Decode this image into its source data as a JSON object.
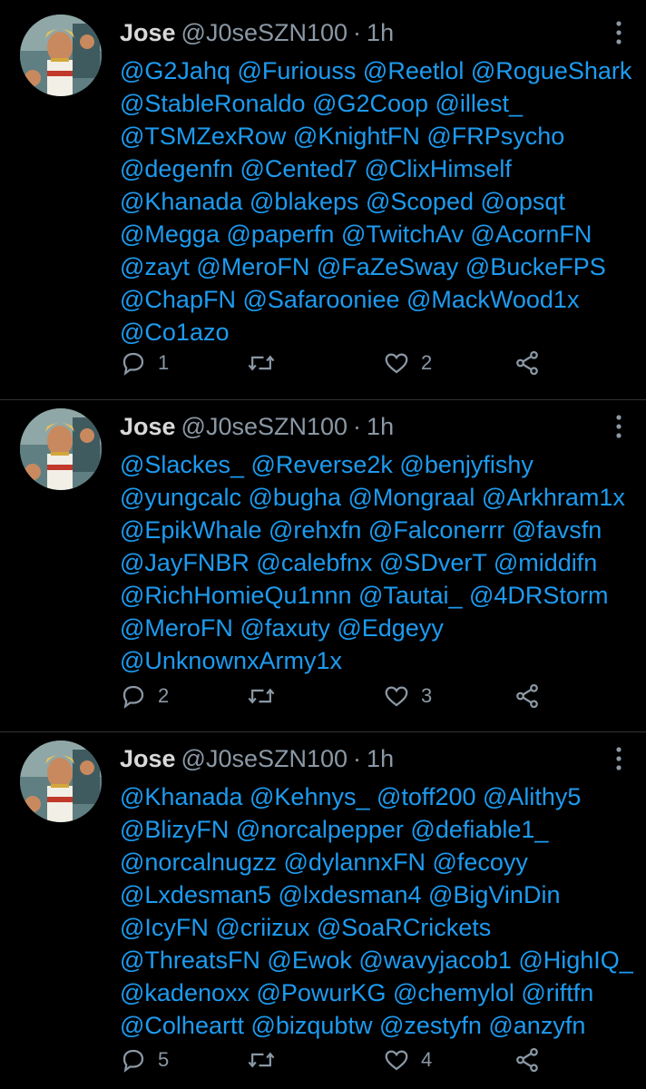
{
  "colors": {
    "background": "#000000",
    "divider": "#2f3336",
    "name": "#d9d9d9",
    "secondary": "#8b98a5",
    "mention": "#1d9bf0"
  },
  "icons": {
    "reply": "comment-bubble-icon",
    "retweet": "retweet-arrows-icon",
    "like": "heart-icon",
    "share": "share-nodes-icon",
    "more": "vertical-ellipsis-icon"
  },
  "tweets": [
    {
      "name": "Jose",
      "handle": "@J0seSZN100",
      "dot": "·",
      "time": "1h",
      "lines": [
        "@G2Jahq @Furiouss @Reetlol @RogueShark",
        "@StableRonaldo @G2Coop @illest_",
        "@TSMZexRow @KnightFN @FRPsycho",
        "@degenfn @Cented7 @ClixHimself",
        "@Khanada @blakeps @Scoped @opsqt",
        "@Megga @paperfn @TwitchAv @AcornFN",
        "@zayt @MeroFN @FaZeSway @BuckeFPS",
        "@ChapFN @Safarooniee @MackWood1x",
        "@Co1azo"
      ],
      "replies": "1",
      "likes": "2"
    },
    {
      "name": "Jose",
      "handle": "@J0seSZN100",
      "dot": "·",
      "time": "1h",
      "lines": [
        "@Slackes_ @Reverse2k @benjyfishy",
        "@yungcalc @bugha @Mongraal @Arkhram1x",
        "@EpikWhale @rehxfn @Falconerrr @favsfn",
        "@JayFNBR @calebfnx @SDverT @middifn",
        "@RichHomieQu1nnn @Tautai_ @4DRStorm",
        "@MeroFN @faxuty @Edgeyy",
        "@UnknownxArmy1x"
      ],
      "replies": "2",
      "likes": "3"
    },
    {
      "name": "Jose",
      "handle": "@J0seSZN100",
      "dot": "·",
      "time": "1h",
      "lines": [
        "@Khanada @Kehnys_ @toff200 @Alithy5",
        "@BlizyFN @norcalpepper @defiable1_",
        "@norcalnugzz @dylannxFN @fecoyy",
        "@Lxdesman5 @lxdesman4 @BigVinDin",
        "@IcyFN @criizux @SoaRCrickets",
        "@ThreatsFN @Ewok @wavyjacob1 @HighIQ_",
        "@kadenoxx @PowurKG @chemylol @riftfn",
        "@Colheartt @bizqubtw @zestyfn @anzyfn"
      ],
      "replies": "5",
      "likes": "4"
    }
  ]
}
